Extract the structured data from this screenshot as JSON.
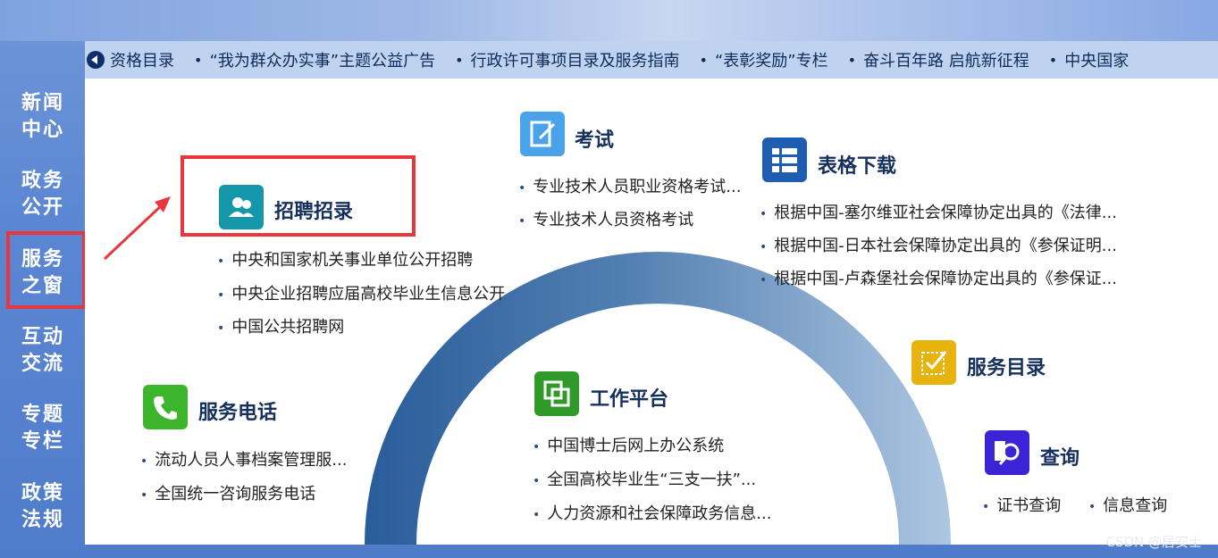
{
  "ticker": {
    "items": [
      {
        "label": "资格目录"
      },
      {
        "label": "“我为群众办实事”主题公益广告"
      },
      {
        "label": "行政许可事项目录及服务指南"
      },
      {
        "label": "“表彰奖励”专栏"
      },
      {
        "label": "奋斗百年路 启航新征程"
      },
      {
        "label": "中央国家"
      }
    ]
  },
  "sidebar": {
    "items": [
      {
        "line1": "新闻",
        "line2": "中心"
      },
      {
        "line1": "政务",
        "line2": "公开"
      },
      {
        "line1": "服务",
        "line2": "之窗"
      },
      {
        "line1": "互动",
        "line2": "交流"
      },
      {
        "line1": "专题",
        "line2": "专栏"
      },
      {
        "line1": "政策",
        "line2": "法规"
      }
    ]
  },
  "sections": {
    "recruit": {
      "title": "招聘招录",
      "links": [
        "中央和国家机关事业单位公开招聘",
        "中央企业招聘应届高校毕业生信息公开",
        "中国公共招聘网"
      ]
    },
    "exam": {
      "title": "考试",
      "links": [
        "专业技术人员职业资格考试...",
        "专业技术人员资格考试"
      ]
    },
    "forms": {
      "title": "表格下载",
      "links": [
        "根据中国-塞尔维亚社会保障协定出具的《法律...",
        "根据中国-日本社会保障协定出具的《参保证明...",
        "根据中国-卢森堡社会保障协定出具的《参保证..."
      ]
    },
    "hotline": {
      "title": "服务电话",
      "links": [
        "流动人员人事档案管理服...",
        "全国统一咨询服务电话"
      ]
    },
    "workspace": {
      "title": "工作平台",
      "links": [
        "中国博士后网上办公系统",
        "全国高校毕业生“三支一扶”...",
        "人力资源和社会保障政务信息..."
      ]
    },
    "catalog": {
      "title": "服务目录"
    },
    "query": {
      "title": "查询",
      "links": [
        "证书查询",
        "信息查询"
      ]
    }
  },
  "colors": {
    "exam": "#4aa3e8",
    "forms": "#1e5db0",
    "recruit": "#1497a8",
    "hotline": "#3bb52c",
    "workspace": "#2f9a2a",
    "catalog": "#e7b40f",
    "query": "#3a24d6",
    "highlight": "#e8373c"
  },
  "watermark": "CSDN @居安士"
}
